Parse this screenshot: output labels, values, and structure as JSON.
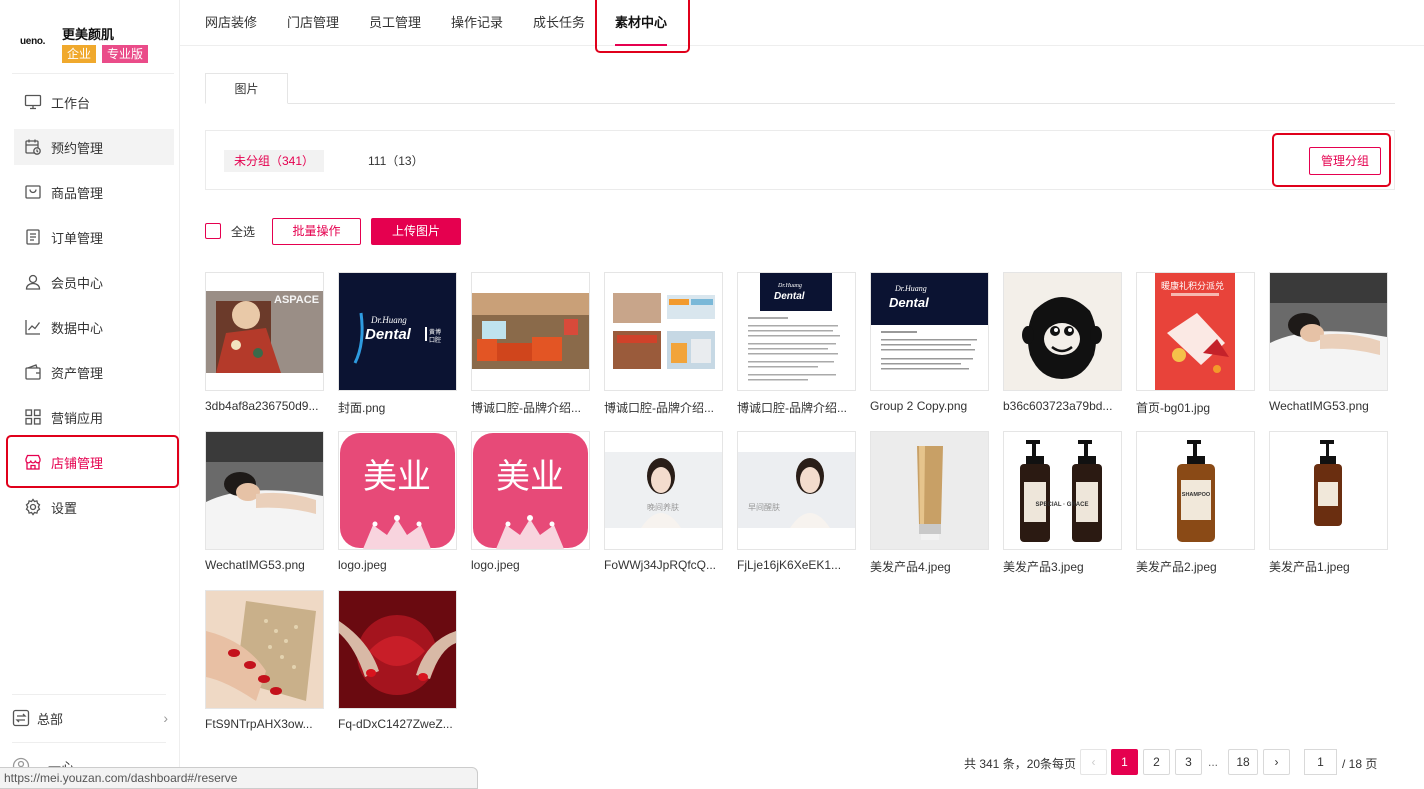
{
  "brand": {
    "logo_text": "ueno.",
    "name": "更美颜肌",
    "badge_enterprise": "企业",
    "badge_pro": "专业版"
  },
  "sidebar": {
    "items": [
      {
        "label": "工作台",
        "icon": "monitor-icon"
      },
      {
        "label": "预约管理",
        "icon": "calendar-icon"
      },
      {
        "label": "商品管理",
        "icon": "box-icon"
      },
      {
        "label": "订单管理",
        "icon": "list-icon"
      },
      {
        "label": "会员中心",
        "icon": "user-icon"
      },
      {
        "label": "数据中心",
        "icon": "chart-icon"
      },
      {
        "label": "资产管理",
        "icon": "wallet-icon"
      },
      {
        "label": "营销应用",
        "icon": "apps-icon"
      },
      {
        "label": "店铺管理",
        "icon": "store-icon"
      },
      {
        "label": "设置",
        "icon": "gear-icon"
      }
    ],
    "hq_label": "总部",
    "user_label": "一心"
  },
  "status_url": "https://mei.youzan.com/dashboard#/reserve",
  "top_tabs": [
    "网店装修",
    "门店管理",
    "员工管理",
    "操作记录",
    "成长任务",
    "素材中心"
  ],
  "sub_tab": "图片",
  "groups": {
    "selected": "未分组（341）",
    "other": "111（13）",
    "manage_label": "管理分组"
  },
  "toolbar": {
    "select_all": "全选",
    "batch": "批量操作",
    "upload": "上传图片"
  },
  "images": [
    {
      "name": "3db4af8a236750d9...",
      "brand_text": "ASPACE"
    },
    {
      "name": "封面.png",
      "brand_text": "Dental"
    },
    {
      "name": "博诚口腔-品牌介绍..."
    },
    {
      "name": "博诚口腔-品牌介绍..."
    },
    {
      "name": "博诚口腔-品牌介绍...",
      "brand_text": "Dental"
    },
    {
      "name": "Group 2 Copy.png",
      "brand_text": "Dental"
    },
    {
      "name": "b36c603723a79bd..."
    },
    {
      "name": "首页-bg01.jpg",
      "brand_text": "暖康礼积分派兑"
    },
    {
      "name": "WechatIMG53.png"
    },
    {
      "name": "WechatIMG53.png"
    },
    {
      "name": "logo.jpeg",
      "brand_text": "美业"
    },
    {
      "name": "logo.jpeg",
      "brand_text": "美业"
    },
    {
      "name": "FoWWj34JpRQfcQ...",
      "brand_text": "晚间养肤"
    },
    {
      "name": "FjLje16jK6XeEK1...",
      "brand_text": "早间醒肤"
    },
    {
      "name": "美发产品4.jpeg"
    },
    {
      "name": "美发产品3.jpeg",
      "brand_text": "SPECIAL · GRACE"
    },
    {
      "name": "美发产品2.jpeg",
      "brand_text": "SHAMPOO"
    },
    {
      "name": "美发产品1.jpeg"
    },
    {
      "name": "FtS9NTrpAHX3ow..."
    },
    {
      "name": "Fq-dDxC1427ZweZ..."
    }
  ],
  "pagination": {
    "total_text": "共 341 条，20条每页",
    "prev": "‹",
    "pages": [
      "1",
      "2",
      "3"
    ],
    "dots": "...",
    "last": "18",
    "next": "›",
    "current_input": "1",
    "suffix": "/ 18 页"
  },
  "colors": {
    "accent": "#e5004f",
    "annotation": "#e0001b"
  }
}
